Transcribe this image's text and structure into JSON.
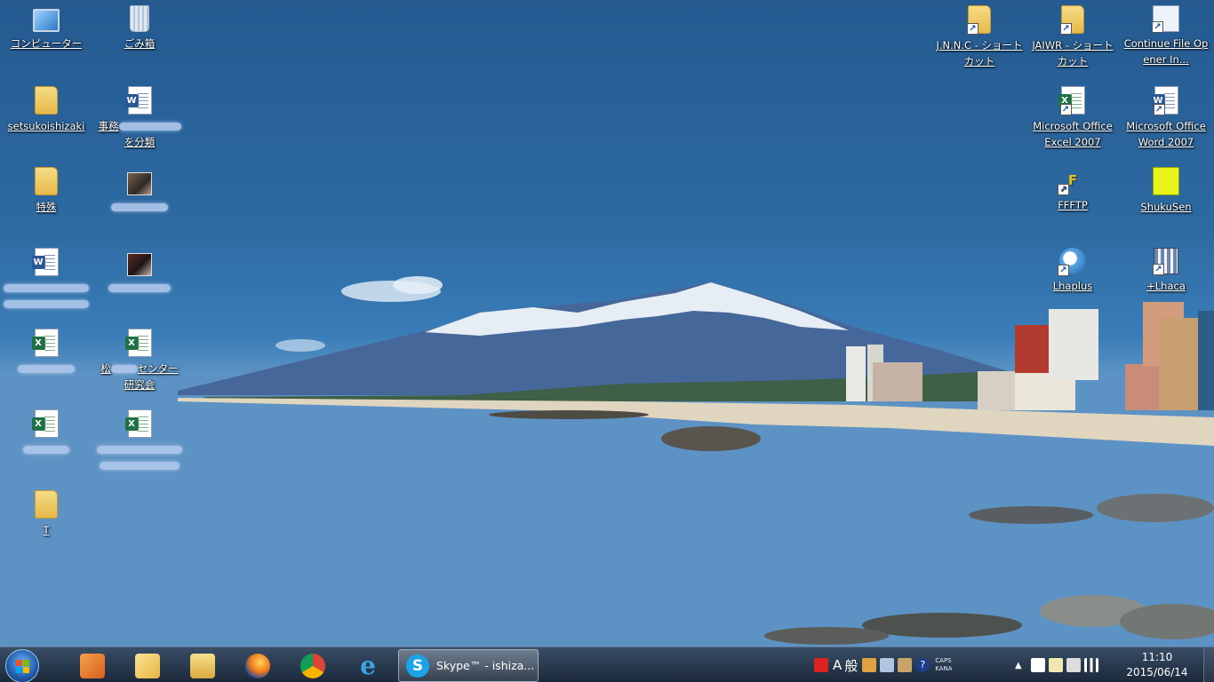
{
  "desktop": {
    "icons_left": [
      {
        "id": "computer",
        "label": "コンピューター",
        "icon": "computer-icon"
      },
      {
        "id": "recycle-bin",
        "label": "ごみ箱",
        "icon": "recycle-bin-icon"
      },
      {
        "id": "user-folder",
        "label": "setsukoishizaki",
        "icon": "user-folder-icon"
      },
      {
        "id": "word-doc-1",
        "label_prefix": "事務",
        "label_suffix": "を分類",
        "icon": "word-document-icon"
      },
      {
        "id": "folder-tokushu",
        "label": "特殊",
        "icon": "folder-icon"
      },
      {
        "id": "photo-1",
        "label": "",
        "icon": "photo-icon"
      },
      {
        "id": "word-doc-2",
        "label": "",
        "icon": "word-document-icon"
      },
      {
        "id": "photo-2",
        "label_prefix": "",
        "icon": "photo-icon"
      },
      {
        "id": "excel-1",
        "label": "",
        "icon": "excel-document-icon"
      },
      {
        "id": "excel-2",
        "label_prefix": "松",
        "label_mid": "センター",
        "label_suffix": "研究会",
        "icon": "excel-document-icon"
      },
      {
        "id": "excel-3",
        "label": "",
        "icon": "excel-document-icon"
      },
      {
        "id": "excel-4",
        "label": "",
        "icon": "excel-document-icon"
      },
      {
        "id": "folder-t",
        "label": "T",
        "icon": "folder-icon"
      }
    ],
    "icons_right": [
      {
        "id": "jnnc",
        "label": "J.N.N.C - ショートカット",
        "icon": "shortcut-folder-icon"
      },
      {
        "id": "jaiwr",
        "label": "JAIWR - ショートカット",
        "icon": "shortcut-folder-icon"
      },
      {
        "id": "continue-file",
        "label": "Continue File Opener In...",
        "icon": "app-window-icon"
      },
      {
        "id": "excel-2007",
        "label": "Microsoft Office Excel 2007",
        "icon": "excel-app-icon"
      },
      {
        "id": "word-2007",
        "label": "Microsoft Office Word 2007",
        "icon": "word-app-icon"
      },
      {
        "id": "ffftp",
        "label": "FFFTP",
        "icon": "ffftp-icon"
      },
      {
        "id": "shukusen",
        "label": "ShukuSen",
        "icon": "shukusen-icon"
      },
      {
        "id": "lhaplus",
        "label": "Lhaplus",
        "icon": "lhaplus-icon"
      },
      {
        "id": "lhaca",
        "label": "+Lhaca",
        "icon": "lhaca-icon"
      }
    ],
    "colors": {
      "sky": "#2d6aa2",
      "sea": "#164f86",
      "label_text": "#ffffff"
    }
  },
  "taskbar": {
    "start_icon": "windows-start-icon",
    "pinned": [
      {
        "id": "media-center",
        "icon": "media-center-icon",
        "color": "#e67a2a"
      },
      {
        "id": "mail",
        "icon": "mail-icon",
        "color": "#f1c35a"
      },
      {
        "id": "explorer",
        "icon": "file-explorer-icon",
        "color": "#e8c45a"
      },
      {
        "id": "firefox",
        "icon": "firefox-icon",
        "color": "#e86a1f"
      },
      {
        "id": "chrome",
        "icon": "chrome-icon",
        "color": "#d8402f"
      },
      {
        "id": "ie",
        "icon": "internet-explorer-icon",
        "color": "#3aa3e8"
      }
    ],
    "active_window": {
      "label": "Skype™ - ishiza...",
      "icon": "skype-icon"
    },
    "tray": {
      "ime_letter": "A",
      "ime_mode": "般",
      "caps": "CAPS",
      "kana": "KANA",
      "help": "?",
      "clock_time": "11:10",
      "clock_date": "2015/06/14"
    }
  }
}
